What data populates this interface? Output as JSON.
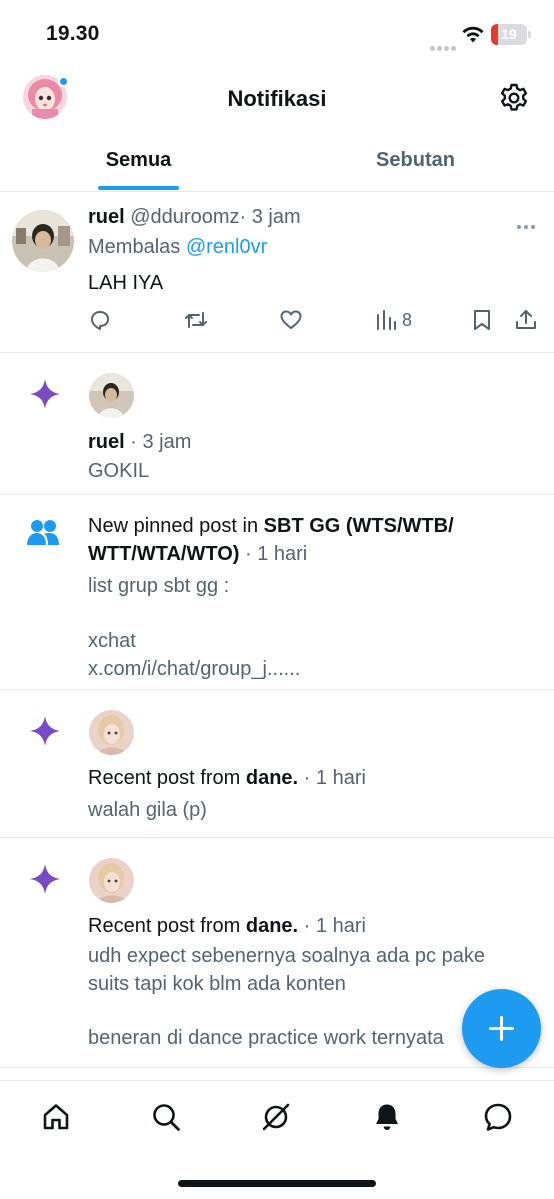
{
  "status_bar": {
    "time": "19.30",
    "battery": "19",
    "battery_level": 0.19
  },
  "header": {
    "title": "Notifikasi",
    "avatar_icon": "profile-avatar",
    "settings_icon": "gear-icon"
  },
  "tabs": [
    {
      "label": "Semua",
      "active": true
    },
    {
      "label": "Sebutan",
      "active": false
    }
  ],
  "notifications": [
    {
      "type": "reply",
      "name": "ruel",
      "handle": "@dduroomz",
      "time": "· 3 jam",
      "reply_prefix": "Membalas",
      "reply_to": "@renl0vr",
      "body": "LAH IYA",
      "views": "8"
    },
    {
      "type": "recommendation",
      "name": "ruel",
      "time": "· 3 jam",
      "body": "GOKIL"
    },
    {
      "type": "community",
      "prefix": "New pinned post in",
      "community_line1": "SBT GG (WTS/WTB/",
      "community_line2": "WTT/WTA/WTO)",
      "time": "· 1 hari",
      "body_line1": "list grup sbt gg :",
      "body_line2": "xchat",
      "body_line3": "x.com/i/chat/group_j......"
    },
    {
      "type": "recent-post",
      "prefix": "Recent post from",
      "name": "dane.",
      "time": "· 1 hari",
      "body": "walah gila (p)"
    },
    {
      "type": "recent-post",
      "prefix": "Recent post from",
      "name": "dane.",
      "time": "· 1 hari",
      "body_line1": "udh expect sebenernya soalnya ada pc pake",
      "body_line2": "suits tapi kok blm ada konten",
      "body_line3": "beneran di dance practice work ternyata"
    }
  ],
  "bottom_nav": [
    "home-icon",
    "search-icon",
    "grok-icon",
    "notifications-bell-icon",
    "messages-icon"
  ],
  "colors": {
    "accent": "#1d9bf0",
    "sparkle": "#794bc4",
    "text": "#0f1419",
    "muted": "#536471"
  }
}
